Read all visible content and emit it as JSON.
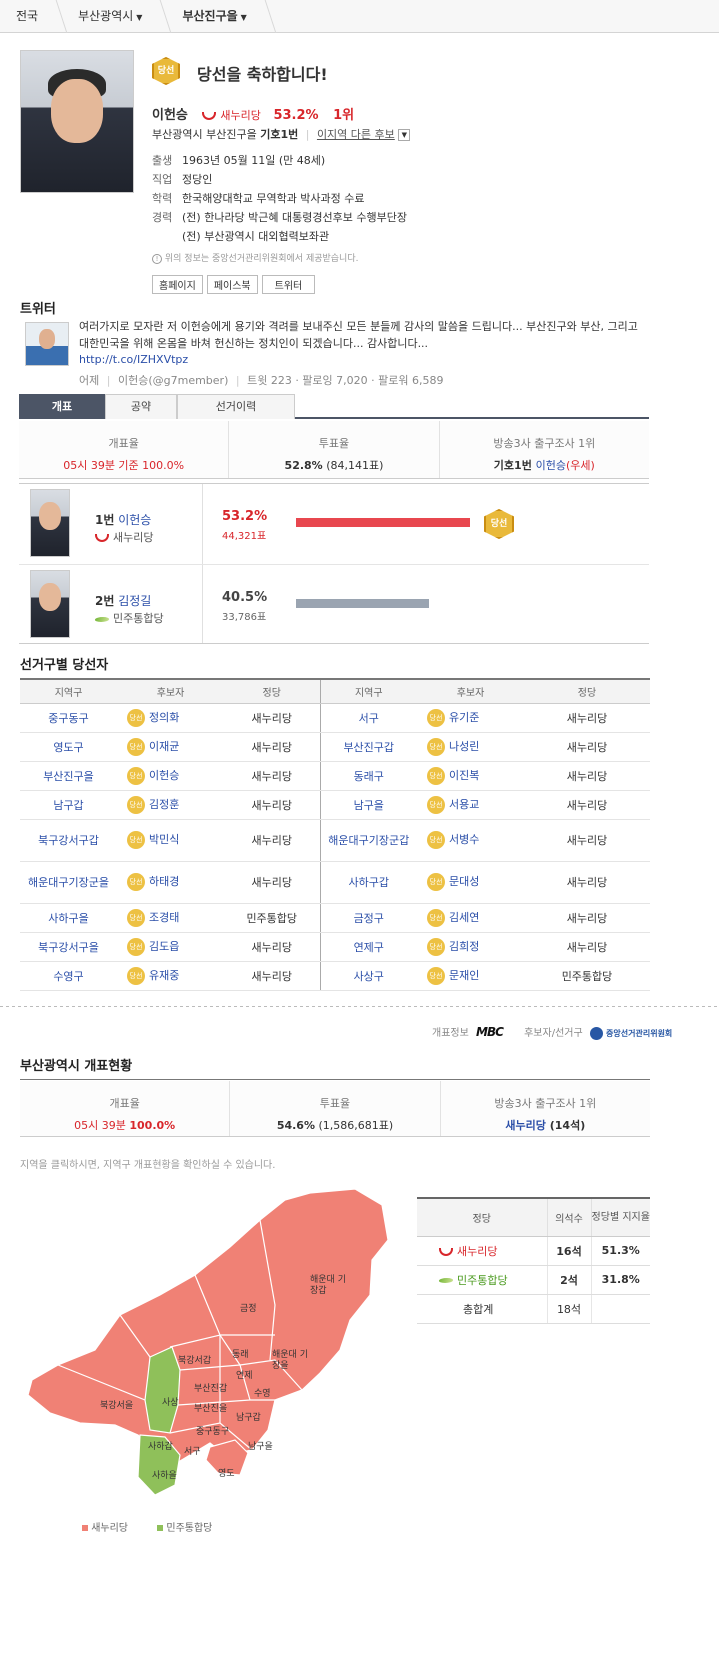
{
  "breadcrumb": {
    "nation": "전국",
    "city": "부산광역시",
    "district": "부산진구을"
  },
  "candidate": {
    "congrats_badge": "당선",
    "congrats_text": "당선을 축하합니다!",
    "name": "이헌승",
    "party": "새누리당",
    "pct": "53.2%",
    "rank": "1위",
    "district_line_prefix": "부산광역시 부산진구을 ",
    "number_label": "기호1번",
    "other_candidates": "이지역 다른 후보",
    "info": [
      {
        "k": "출생",
        "v": "1963년 05월 11일 (만 48세)"
      },
      {
        "k": "직업",
        "v": "정당인"
      },
      {
        "k": "학력",
        "v": "한국해양대학교 무역학과 박사과정 수료"
      },
      {
        "k": "경력",
        "v": "(전) 한나라당 박근혜 대통령경선후보 수행부단장"
      },
      {
        "k": "",
        "v": "(전) 부산광역시 대외협력보좌관"
      }
    ],
    "source_note": "위의 정보는 중앙선거관리위원회에서 제공받습니다.",
    "buttons": [
      "홈페이지",
      "페이스북",
      "트위터"
    ]
  },
  "twitter": {
    "title": "트위터",
    "text": "여러가지로 모자란 저 이헌승에게 용기와 격려를 보내주신 모든 분들께 감사의 말씀을 드립니다... 부산진구와 부산, 그리고 대한민국을 위해 온몸을 바쳐 헌신하는 정치인이 되겠습니다... 감사합니다...",
    "link": "http://t.co/IZHXVtpz",
    "meta_date": "어제",
    "meta_user": "이헌승(@g7member)",
    "meta_stats": "트윗 223 · 팔로잉 7,020 · 팔로워 6,589"
  },
  "tabs": [
    "개표",
    "공약",
    "선거이력"
  ],
  "district_summary": {
    "count_label": "개표율",
    "count_value": "05시 39분 기준 100.0%",
    "turnout_label": "투표율",
    "turnout_value_bold": "52.8%",
    "turnout_value_rest": " (84,141표)",
    "exit_label": "방송3사 출구조사 1위",
    "exit_value_prefix": "기호1번 ",
    "exit_value_name": "이헌승",
    "exit_value_suffix": "(우세)"
  },
  "results": [
    {
      "num": "1번",
      "name": "이헌승",
      "party": "새누리당",
      "pct": "53.2%",
      "votes": "44,321표",
      "share": 53.2,
      "color": "#e8474f",
      "winner": "당선"
    },
    {
      "num": "2번",
      "name": "김정길",
      "party": "민주통합당",
      "pct": "40.5%",
      "votes": "33,786표",
      "share": 40.5,
      "color": "#9aa4b1",
      "winner": ""
    }
  ],
  "winners": {
    "title": "선거구별 당선자",
    "headers": [
      "지역구",
      "후보자",
      "정당",
      "지역구",
      "후보자",
      "정당"
    ],
    "badge": "당선",
    "rows": [
      [
        "중구동구",
        "정의화",
        "새누리당",
        "서구",
        "유기준",
        "새누리당"
      ],
      [
        "영도구",
        "이재균",
        "새누리당",
        "부산진구갑",
        "나성린",
        "새누리당"
      ],
      [
        "부산진구을",
        "이헌승",
        "새누리당",
        "동래구",
        "이진복",
        "새누리당"
      ],
      [
        "남구갑",
        "김정훈",
        "새누리당",
        "남구을",
        "서용교",
        "새누리당"
      ],
      [
        "북구강서구갑",
        "박민식",
        "새누리당",
        "해운대구기장군갑",
        "서병수",
        "새누리당"
      ],
      [
        "해운대구기장군을",
        "하태경",
        "새누리당",
        "사하구갑",
        "문대성",
        "새누리당"
      ],
      [
        "사하구을",
        "조경태",
        "민주통합당",
        "금정구",
        "김세연",
        "새누리당"
      ],
      [
        "북구강서구을",
        "김도읍",
        "새누리당",
        "연제구",
        "김희정",
        "새누리당"
      ],
      [
        "수영구",
        "유재중",
        "새누리당",
        "사상구",
        "문재인",
        "민주통합당"
      ]
    ]
  },
  "source_bar": {
    "count_info": "개표정보",
    "mbc": "MBC",
    "candidate_info": "후보자/선거구",
    "nec": "중앙선거관리위원회"
  },
  "city_summary": {
    "title": "부산광역시 개표현황",
    "count_label": "개표율",
    "count_value_pre": "05시 39분 ",
    "count_value_bold": "100.0%",
    "turnout_label": "투표율",
    "turnout_value_bold": "54.6%",
    "turnout_value_rest": " (1,586,681표)",
    "exit_label": "방송3사 출구조사 1위",
    "exit_party": "새누리당",
    "exit_seats": " (14석)"
  },
  "map": {
    "hint": "지역을 클릭하시면, 지역구 개표현황을 확인하실 수 있습니다.",
    "labels": [
      "해운대 기장갑",
      "금정",
      "북강서갑",
      "동래",
      "해운대 기장을",
      "연제",
      "사상",
      "부산진갑",
      "수영",
      "북강서을",
      "부산진을",
      "남구갑",
      "중구동구",
      "사하갑",
      "서구",
      "남구을",
      "사하을",
      "영도"
    ],
    "legend": [
      "새누리당",
      "민주통합당"
    ],
    "colors": {
      "saenuri": "#f08175",
      "minju": "#8fc05a"
    }
  },
  "party_table": {
    "headers": [
      "정당",
      "의석수",
      "정당별 지지율"
    ],
    "rows": [
      {
        "party": "새누리당",
        "seats": "16석",
        "support": "51.3%"
      },
      {
        "party": "민주통합당",
        "seats": "2석",
        "support": "31.8%"
      }
    ],
    "total_label": "총합계",
    "total_seats": "18석"
  }
}
